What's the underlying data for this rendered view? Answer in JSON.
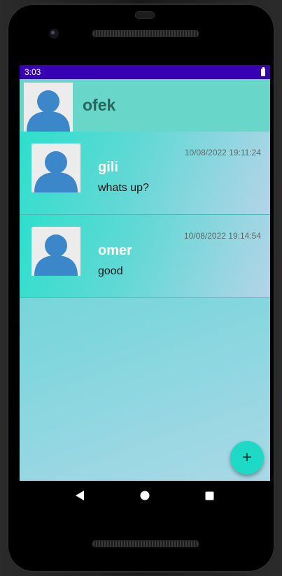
{
  "status_bar": {
    "time": "3:03",
    "battery_icon": "battery-icon"
  },
  "header": {
    "user_name": "ofek",
    "avatar_icon": "person-avatar-icon"
  },
  "chats": [
    {
      "name": "gili",
      "last_message": "whats up?",
      "time": "10/08/2022 19:11:24"
    },
    {
      "name": "omer",
      "last_message": "good",
      "time": "10/08/2022 19:14:54"
    }
  ],
  "fab": {
    "label": "+",
    "icon": "add-icon"
  },
  "nav": {
    "back_icon": "back-triangle-icon",
    "home_icon": "home-circle-icon",
    "recents_icon": "recents-square-icon"
  },
  "colors": {
    "status_bar": "#3700b3",
    "header": "#68d6c8",
    "accent": "#1ed9c6",
    "avatar_figure": "#3b87c9"
  }
}
